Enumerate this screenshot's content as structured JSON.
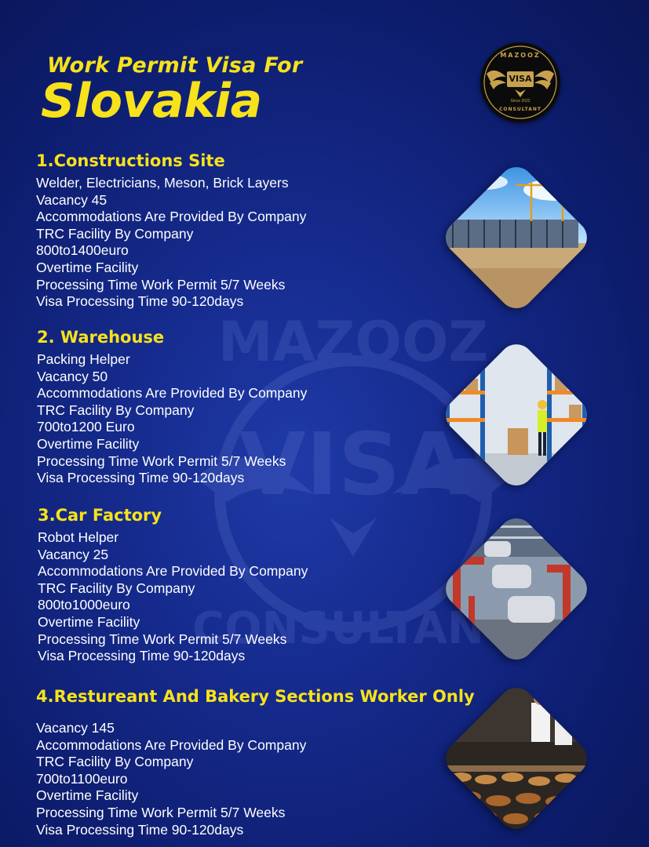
{
  "header": {
    "title_line1": "Work Permit Visa For",
    "title_line2": "Slovakia"
  },
  "logo": {
    "top_text": "MAZOOZ",
    "center_text": "VISA",
    "since_text": "Since 2022",
    "bottom_text": "CONSULTANT",
    "icon": "eagle-wings-icon",
    "colors": {
      "gold": "#c8a24c",
      "background": "#0b0b0b"
    }
  },
  "colors": {
    "heading": "#f7e21b",
    "text": "#ffffff",
    "background": "#152a8c"
  },
  "sections": [
    {
      "heading": "1.Constructions Site",
      "items": [
        "Welder, Electricians, Meson, Brick Layers",
        "Vacancy 45",
        "Accommodations Are Provided By Company",
        "TRC Facility By Company",
        "800to1400euro",
        "Overtime Facility",
        "Processing Time Work Permit 5/7 Weeks",
        "Visa Processing Time 90-120days"
      ],
      "image": "construction-site-photo"
    },
    {
      "heading": "2. Warehouse",
      "items": [
        "Packing Helper",
        "Vacancy 50",
        "Accommodations Are Provided By Company",
        "TRC Facility By Company",
        "700to1200 Euro",
        "Overtime Facility",
        "Processing Time Work Permit 5/7 Weeks",
        "Visa Processing Time 90-120days"
      ],
      "image": "warehouse-photo"
    },
    {
      "heading": "3.Car Factory",
      "items": [
        "Robot Helper",
        "Vacancy 25",
        "Accommodations Are Provided By Company",
        "TRC Facility By Company",
        "800to1000euro",
        "Overtime Facility",
        "Processing Time Work Permit 5/7 Weeks",
        "Visa Processing Time 90-120days"
      ],
      "image": "car-factory-photo"
    },
    {
      "heading": "4.Restureant And Bakery Sections Worker Only",
      "items": [
        "Vacancy 145",
        "Accommodations Are Provided By Company",
        "TRC Facility By Company",
        "700to1100euro",
        "Overtime Facility",
        "Processing Time Work Permit 5/7 Weeks",
        "Visa Processing Time 90-120days"
      ],
      "image": "bakery-photo"
    }
  ]
}
